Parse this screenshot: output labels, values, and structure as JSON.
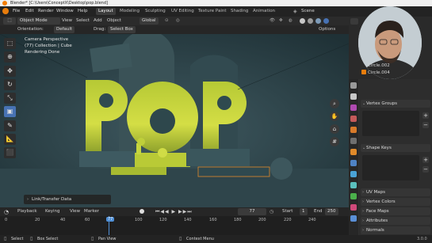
{
  "window_title": "Blender* [C:\\Users\\ConceptX\\Desktop\\pop.blend]",
  "menu": [
    "File",
    "Edit",
    "Render",
    "Window",
    "Help"
  ],
  "workspaces": [
    "Layout",
    "Modeling",
    "Sculpting",
    "UV Editing",
    "Texture Paint",
    "Shading",
    "Animation"
  ],
  "scene_label": "Scene",
  "header": {
    "mode": "Object Mode",
    "view": "View",
    "select": "Select",
    "add": "Add",
    "object": "Object",
    "transform": "Global"
  },
  "tool_header": {
    "orientation_label": "Orientation:",
    "orientation_value": "Default",
    "drag_label": "Drag:",
    "drag_value": "Select Box",
    "options": "Options"
  },
  "viewport": {
    "line1": "Camera Perspective",
    "line2": "(77) Collection | Cube",
    "line3": "Rendering Done",
    "title_text": "POP",
    "link_panel": "Link/Transfer Data"
  },
  "outliner": {
    "rows": [
      "Circle.002",
      "Circle.004"
    ]
  },
  "properties": {
    "sections": [
      "Vertex Groups",
      "Shape Keys",
      "UV Maps",
      "Vertex Colors",
      "Face Maps",
      "Attributes",
      "Normals"
    ]
  },
  "timeline": {
    "menus": [
      "Playback",
      "Keying",
      "View",
      "Marker"
    ],
    "ticks": [
      "0",
      "20",
      "40",
      "60",
      "77",
      "100",
      "120",
      "140",
      "160",
      "180",
      "200",
      "220",
      "240"
    ],
    "current_frame": "77",
    "current_frame_box": "77",
    "start_label": "Start",
    "start_value": "1",
    "end_label": "End",
    "end_value": "250"
  },
  "status": {
    "select": "Select",
    "box_select": "Box Select",
    "pan_view": "Pan View",
    "context_menu": "Context Menu",
    "version": "3.0.0"
  },
  "colors": {
    "accent_blue": "#4772b3",
    "text_yellow_green": "#c9d640",
    "viewport_bg": "#2b4047",
    "frame_indicator": "#4f8fd6"
  }
}
